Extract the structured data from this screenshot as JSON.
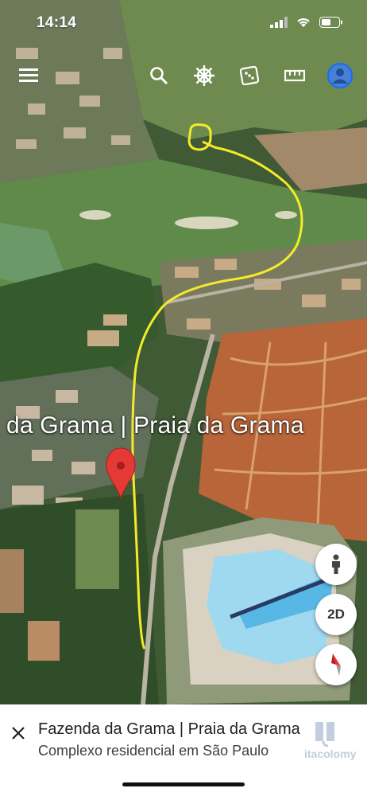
{
  "status_bar": {
    "time": "14:14"
  },
  "toolbar": {
    "icons": [
      "menu-icon",
      "search-icon",
      "voyager-helm-icon",
      "dice-icon",
      "ruler-icon",
      "account-icon"
    ]
  },
  "map": {
    "place_label": "da Grama | Praia da Grama",
    "route_color": "#f5ea2a",
    "pin_color": "#e53935"
  },
  "controls": {
    "view_mode_label": "2D",
    "street_view_icon": "pegman-icon",
    "compass_icon": "compass-icon"
  },
  "place_card": {
    "title": "Fazenda da Grama | Praia da Grama",
    "subtitle": "Complexo residencial em São Paulo",
    "watermark": "itacolomy"
  }
}
